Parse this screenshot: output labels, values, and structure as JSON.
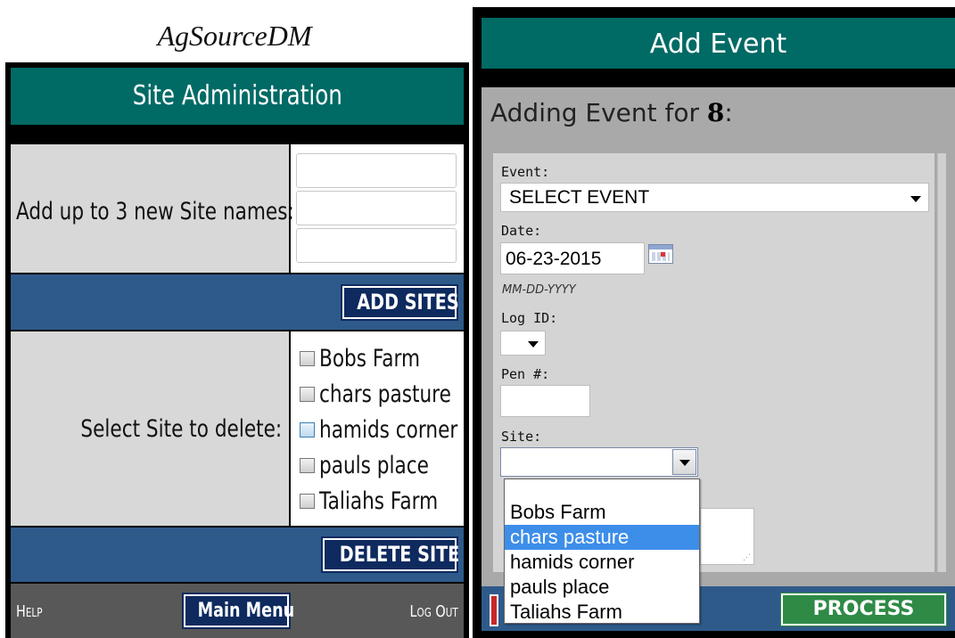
{
  "left": {
    "brand": "AgSourceDM",
    "header_title": "Site Administration",
    "add_label": "Add up to 3 new Site names:",
    "add_button": "ADD SITES",
    "delete_label": "Select Site to delete:",
    "sites": [
      {
        "label": "Bobs Farm",
        "checked": false
      },
      {
        "label": "chars pasture",
        "checked": false
      },
      {
        "label": "hamids corner",
        "checked": false
      },
      {
        "label": "pauls place",
        "checked": false
      },
      {
        "label": "Taliahs Farm",
        "checked": false
      }
    ],
    "delete_button": "DELETE SITE",
    "footer": {
      "help": "Help",
      "main_menu": "Main Menu",
      "logout": "Log Out"
    }
  },
  "right": {
    "header_title": "Add Event",
    "adding_prefix": "Adding Event for ",
    "adding_id": "8",
    "adding_suffix": ":",
    "event_label": "Event:",
    "event_value": "SELECT EVENT",
    "date_label": "Date:",
    "date_value": "06-23-2015",
    "date_hint": "MM-DD-YYYY",
    "logid_label": "Log ID:",
    "pen_label": "Pen #:",
    "site_label": "Site:",
    "site_options": [
      "Bobs Farm",
      "chars pasture",
      "hamids corner",
      "pauls place",
      "Taliahs Farm"
    ],
    "site_highlighted": "chars pasture",
    "process_button": "PROCESS"
  },
  "colors": {
    "header_teal": "#006a65",
    "bar_blue": "#2e5a8a",
    "nav_button": "#0e2a5e",
    "process_green": "#2f8a46",
    "highlight": "#3d8ee9"
  }
}
